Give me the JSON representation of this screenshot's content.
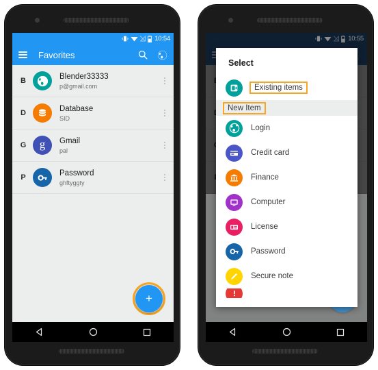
{
  "colors": {
    "accent_blue": "#2196f3",
    "dark_blue": "#1c3a5c",
    "highlight_orange": "#f5a623",
    "teal": "#00a19a",
    "orange": "#f57c00",
    "gmail_blue": "#3f51b5",
    "password_blue": "#1565a8",
    "indigo": "#4a56c8",
    "purple": "#a032c8",
    "pink": "#e91e63",
    "yellow": "#ffd400",
    "red": "#e53935",
    "list_bg": "#eceded"
  },
  "phone1": {
    "status_bar": {
      "time": "10:54",
      "icons": [
        "vibrate-icon",
        "wifi-icon",
        "signal-off-icon",
        "battery-icon"
      ]
    },
    "toolbar": {
      "menu_icon": "hamburger-icon",
      "title": "Favorites",
      "actions": [
        "search-icon",
        "globe-icon"
      ]
    },
    "list": [
      {
        "letter": "B",
        "title": "Blender33333",
        "subtitle": "p@gmail.com",
        "icon": "globe-icon",
        "color": "#00a19a"
      },
      {
        "letter": "D",
        "title": "Database",
        "subtitle": "SID",
        "icon": "database-icon",
        "color": "#f57c00"
      },
      {
        "letter": "G",
        "title": "Gmail",
        "subtitle": "pal",
        "icon": "google-g-icon",
        "color": "#3f51b5"
      },
      {
        "letter": "P",
        "title": "Password",
        "subtitle": "ghftyggty",
        "icon": "key-icon",
        "color": "#1565a8"
      }
    ],
    "fab": {
      "label": "+",
      "name": "add-fab",
      "highlighted": true
    },
    "nav_bar": [
      "back-icon",
      "home-icon",
      "recents-icon"
    ]
  },
  "phone2": {
    "status_bar": {
      "time": "10:55",
      "icons": [
        "vibrate-icon",
        "wifi-icon",
        "signal-off-icon",
        "battery-icon"
      ]
    },
    "toolbar": {
      "menu_icon": "hamburger-icon",
      "title": "",
      "actions": [
        "globe-icon"
      ]
    },
    "dialog": {
      "title": "Select",
      "existing": {
        "label": "Existing items",
        "icon": "import-icon",
        "color": "#00a19a",
        "highlighted": true
      },
      "section_label": "New Item",
      "section_highlighted": true,
      "items": [
        {
          "label": "Login",
          "icon": "globe-icon",
          "color": "#00a19a"
        },
        {
          "label": "Credit card",
          "icon": "credit-card-icon",
          "color": "#4a56c8"
        },
        {
          "label": "Finance",
          "icon": "bank-icon",
          "color": "#f57c00"
        },
        {
          "label": "Computer",
          "icon": "monitor-icon",
          "color": "#a032c8"
        },
        {
          "label": "License",
          "icon": "id-card-icon",
          "color": "#e91e63"
        },
        {
          "label": "Password",
          "icon": "key-icon",
          "color": "#1565a8"
        },
        {
          "label": "Secure note",
          "icon": "pencil-icon",
          "color": "#ffd400"
        },
        {
          "label": "",
          "icon": "alert-icon",
          "color": "#e53935"
        }
      ]
    },
    "nav_bar": [
      "back-icon",
      "home-icon",
      "recents-icon"
    ]
  }
}
